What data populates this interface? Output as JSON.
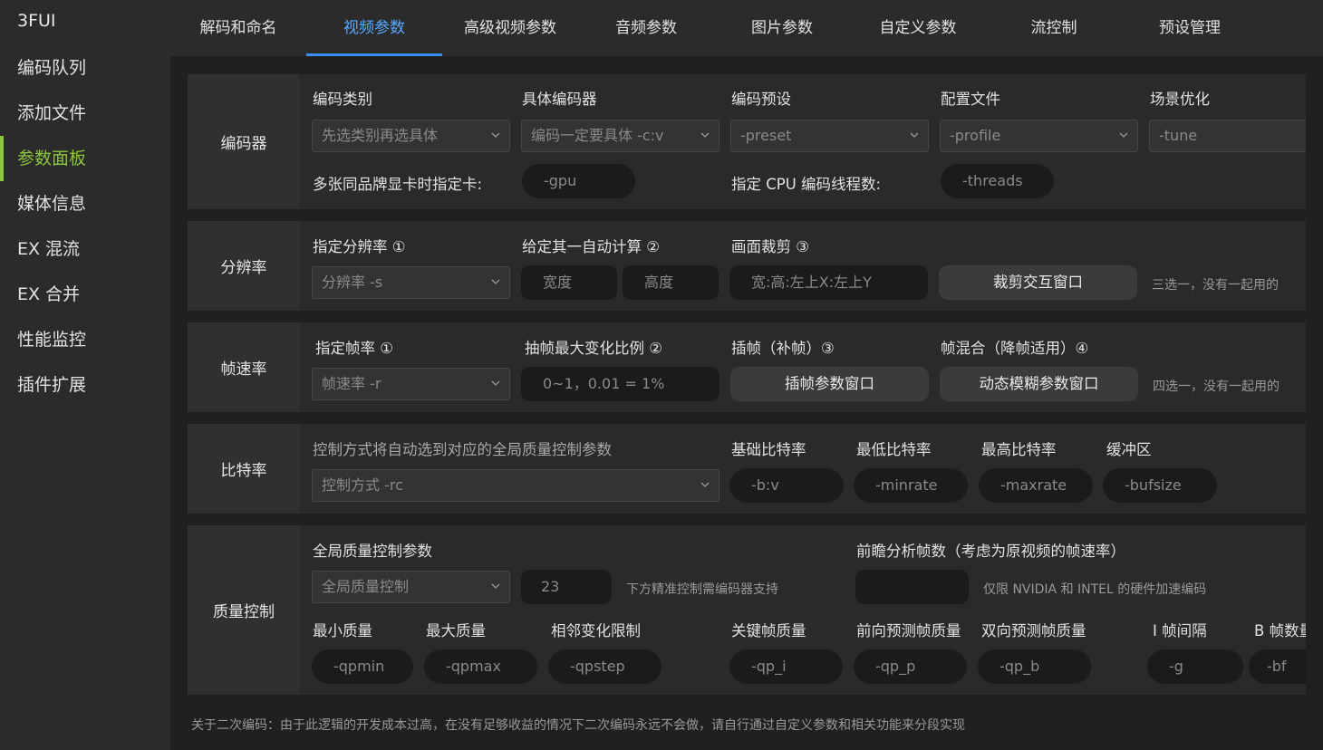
{
  "app": {
    "title": "3FUI"
  },
  "sidebar": {
    "items": [
      {
        "label": "编码队列"
      },
      {
        "label": "添加文件"
      },
      {
        "label": "参数面板"
      },
      {
        "label": "媒体信息"
      },
      {
        "label": "EX 混流"
      },
      {
        "label": "EX 合并"
      },
      {
        "label": "性能监控"
      },
      {
        "label": "插件扩展"
      }
    ],
    "active_index": 2
  },
  "tabs": [
    {
      "label": "解码和命名"
    },
    {
      "label": "视频参数"
    },
    {
      "label": "高级视频参数"
    },
    {
      "label": "音频参数"
    },
    {
      "label": "图片参数"
    },
    {
      "label": "自定义参数"
    },
    {
      "label": "流控制"
    },
    {
      "label": "预设管理"
    }
  ],
  "active_tab": 1,
  "encoder": {
    "title": "编码器",
    "category_label": "编码类别",
    "category_value": "先选类别再选具体",
    "codec_label": "具体编码器",
    "codec_value": "编码一定要具体 -c:v",
    "preset_label": "编码预设",
    "preset_value": "-preset",
    "profile_label": "配置文件",
    "profile_value": "-profile",
    "tune_label": "场景优化",
    "tune_value": "-tune",
    "gpu_label": "多张同品牌显卡时指定卡:",
    "gpu_placeholder": "-gpu",
    "threads_label": "指定 CPU 编码线程数:",
    "threads_placeholder": "-threads"
  },
  "resolution": {
    "title": "分辨率",
    "size_label": "指定分辨率 ①",
    "size_value": "分辨率 -s",
    "auto_label": "给定其一自动计算 ②",
    "width_placeholder": "宽度",
    "height_placeholder": "高度",
    "crop_label": "画面裁剪 ③",
    "crop_placeholder": "宽:高:左上X:左上Y",
    "crop_button": "裁剪交互窗口",
    "note": "三选一，没有一起用的"
  },
  "framerate": {
    "title": "帧速率",
    "rate_label": "指定帧率 ①",
    "rate_value": "帧速率 -r",
    "drop_label": "抽帧最大变化比例 ②",
    "drop_placeholder": "0~1，0.01 = 1%",
    "interp_label": "插帧（补帧）③",
    "interp_button": "插帧参数窗口",
    "blend_label": "帧混合（降帧适用）④",
    "blend_button": "动态模糊参数窗口",
    "note": "四选一，没有一起用的"
  },
  "bitrate": {
    "title": "比特率",
    "mode_hint": "控制方式将自动选到对应的全局质量控制参数",
    "mode_value": "控制方式 -rc",
    "base_label": "基础比特率",
    "base_placeholder": "-b:v",
    "min_label": "最低比特率",
    "min_placeholder": "-minrate",
    "max_label": "最高比特率",
    "max_placeholder": "-maxrate",
    "buf_label": "缓冲区",
    "buf_placeholder": "-bufsize"
  },
  "quality": {
    "title": "质量控制",
    "global_label": "全局质量控制参数",
    "global_value": "全局质量控制",
    "global_number": "23",
    "global_note": "下方精准控制需编码器支持",
    "lookahead_label": "前瞻分析帧数（考虑为原视频的帧速率）",
    "lookahead_note": "仅限 NVIDIA 和 INTEL 的硬件加速编码",
    "qpmin_label": "最小质量",
    "qpmin_placeholder": "-qpmin",
    "qpmax_label": "最大质量",
    "qpmax_placeholder": "-qpmax",
    "qpstep_label": "相邻变化限制",
    "qpstep_placeholder": "-qpstep",
    "qpi_label": "关键帧质量",
    "qpi_placeholder": "-qp_i",
    "qpp_label": "前向预测帧质量",
    "qpp_placeholder": "-qp_p",
    "qpb_label": "双向预测帧质量",
    "qpb_placeholder": "-qp_b",
    "g_label": "I 帧间隔",
    "g_placeholder": "-g",
    "bf_label": "B 帧数量",
    "bf_placeholder": "-bf"
  },
  "footer": {
    "note": "关于二次编码：由于此逻辑的开发成本过高，在没有足够收益的情况下二次编码永远不会做，请自行通过自定义参数和相关功能来分段实现"
  },
  "colors": {
    "accent_green": "#8dc63f",
    "accent_blue": "#3d8df5"
  }
}
